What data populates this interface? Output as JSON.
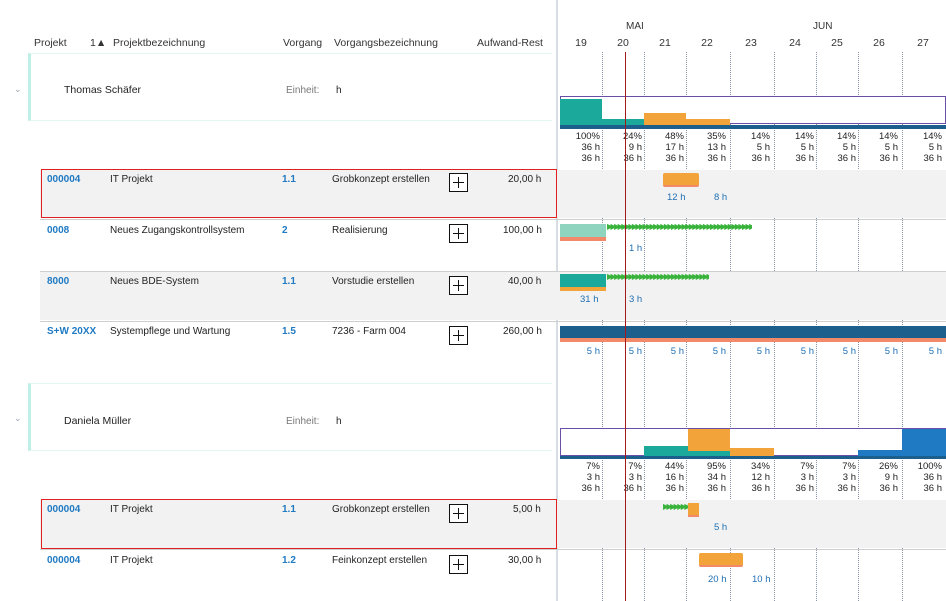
{
  "header": {
    "col_projekt": "Projekt",
    "sort_indicator": "1▲",
    "col_projektbezeichnung": "Projektbezeichnung",
    "col_vorgang": "Vorgang",
    "col_vorgangsbezeichnung": "Vorgangsbezeichnung",
    "col_aufwand_rest": "Aufwand-Rest"
  },
  "timeline": {
    "months": [
      "MAI",
      "JUN"
    ],
    "days": [
      "19",
      "20",
      "21",
      "22",
      "23",
      "24",
      "25",
      "26",
      "27"
    ]
  },
  "groups": [
    {
      "person": "Thomas Schäfer",
      "unit_label": "Einheit:",
      "unit_value": "h",
      "load_pct": [
        "100%",
        "24%",
        "48%",
        "35%",
        "14%",
        "14%",
        "14%",
        "14%",
        "14%"
      ],
      "load_plan": [
        "36 h",
        "9 h",
        "17 h",
        "13 h",
        "5 h",
        "5 h",
        "5 h",
        "5 h",
        "5 h"
      ],
      "load_cap": [
        "36 h",
        "36 h",
        "36 h",
        "36 h",
        "36 h",
        "36 h",
        "36 h",
        "36 h",
        "36 h"
      ],
      "tasks": [
        {
          "projekt": "000004",
          "bezeichnung": "IT Projekt",
          "vorgang": "1.1",
          "vorgangsbezeichnung": "Grobkonzept erstellen",
          "aufwand": "20,00 h",
          "labels": [
            "12 h",
            "8 h"
          ]
        },
        {
          "projekt": "0008",
          "bezeichnung": "Neues Zugangskontrollsystem",
          "vorgang": "2",
          "vorgangsbezeichnung": "Realisierung",
          "aufwand": "100,00 h",
          "labels": [
            "1 h"
          ]
        },
        {
          "projekt": "8000",
          "bezeichnung": "Neues BDE-System",
          "vorgang": "1.1",
          "vorgangsbezeichnung": "Vorstudie erstellen",
          "aufwand": "40,00 h",
          "labels": [
            "31 h",
            "3 h"
          ]
        },
        {
          "projekt": "S+W 20XX",
          "bezeichnung": "Systempflege und Wartung",
          "vorgang": "1.5",
          "vorgangsbezeichnung": "7236 - Farm 004",
          "aufwand": "260,00 h",
          "labels": [
            "5 h",
            "5 h",
            "5 h",
            "5 h",
            "5 h",
            "5 h",
            "5 h",
            "5 h",
            "5 h"
          ]
        }
      ]
    },
    {
      "person": "Daniela Müller",
      "unit_label": "Einheit:",
      "unit_value": "h",
      "load_pct": [
        "7%",
        "7%",
        "44%",
        "95%",
        "34%",
        "7%",
        "7%",
        "26%",
        "100%"
      ],
      "load_plan": [
        "3 h",
        "3 h",
        "16 h",
        "34 h",
        "12 h",
        "3 h",
        "3 h",
        "9 h",
        "36 h"
      ],
      "load_cap": [
        "36 h",
        "36 h",
        "36 h",
        "36 h",
        "36 h",
        "36 h",
        "36 h",
        "36 h",
        "36 h"
      ],
      "tasks": [
        {
          "projekt": "000004",
          "bezeichnung": "IT Projekt",
          "vorgang": "1.1",
          "vorgangsbezeichnung": "Grobkonzept erstellen",
          "aufwand": "5,00 h",
          "labels": [
            "5 h"
          ]
        },
        {
          "projekt": "000004",
          "bezeichnung": "IT Projekt",
          "vorgang": "1.2",
          "vorgangsbezeichnung": "Feinkonzept erstellen",
          "aufwand": "30,00 h",
          "labels": [
            "20 h",
            "10 h"
          ]
        }
      ]
    }
  ],
  "colors": {
    "teal": "#1aa99a",
    "orange": "#f2a33a",
    "salmon": "#f28a6a",
    "navy": "#1c5f8c",
    "blue": "#1f7ac3",
    "red_highlight": "#e02020",
    "today_line": "#a31a1a",
    "arrow_green": "#38b23a"
  }
}
